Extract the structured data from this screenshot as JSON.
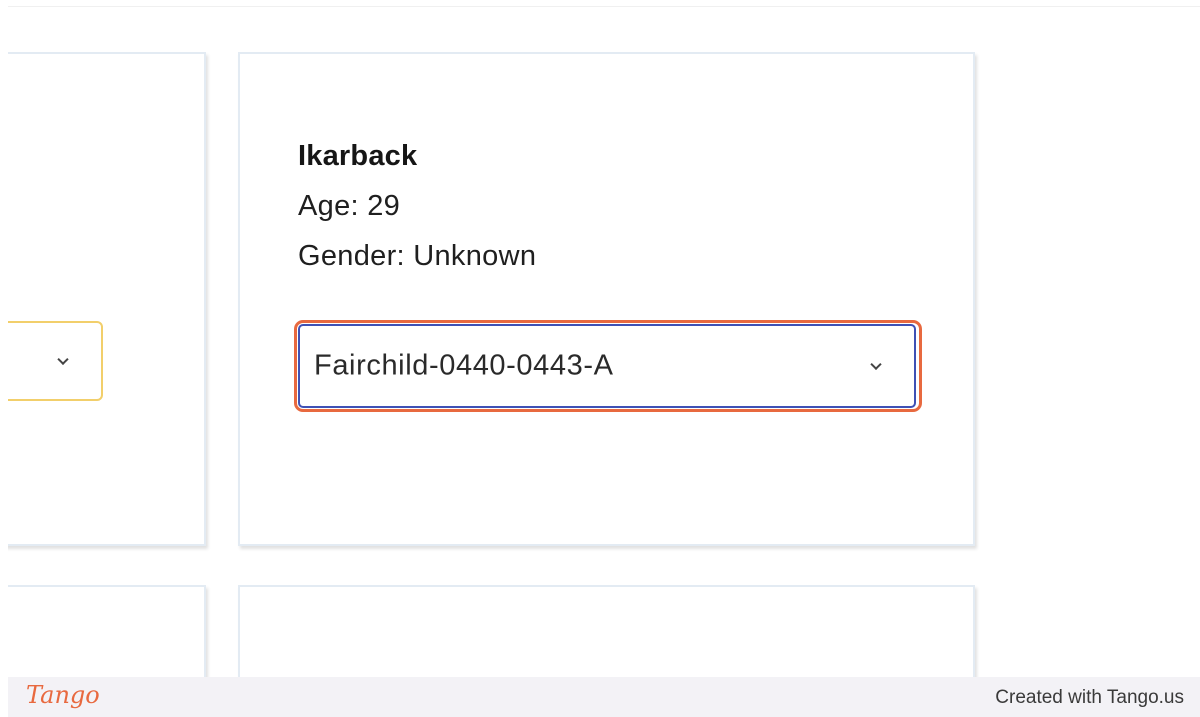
{
  "person": {
    "name": "Ikarback",
    "age": "Age: 29",
    "gender": "Gender: Unknown"
  },
  "dropdown": {
    "selected": "Fairchild-0440-0443-A",
    "icon": "chevron-down-icon"
  },
  "footer": {
    "logo": "Tango",
    "credit": "Created with Tango.us"
  },
  "colors": {
    "highlight": "#e8693f",
    "focus_border": "#3f51b5",
    "left_select_border": "#f2cf6b",
    "card_border": "#e3ebf3"
  }
}
